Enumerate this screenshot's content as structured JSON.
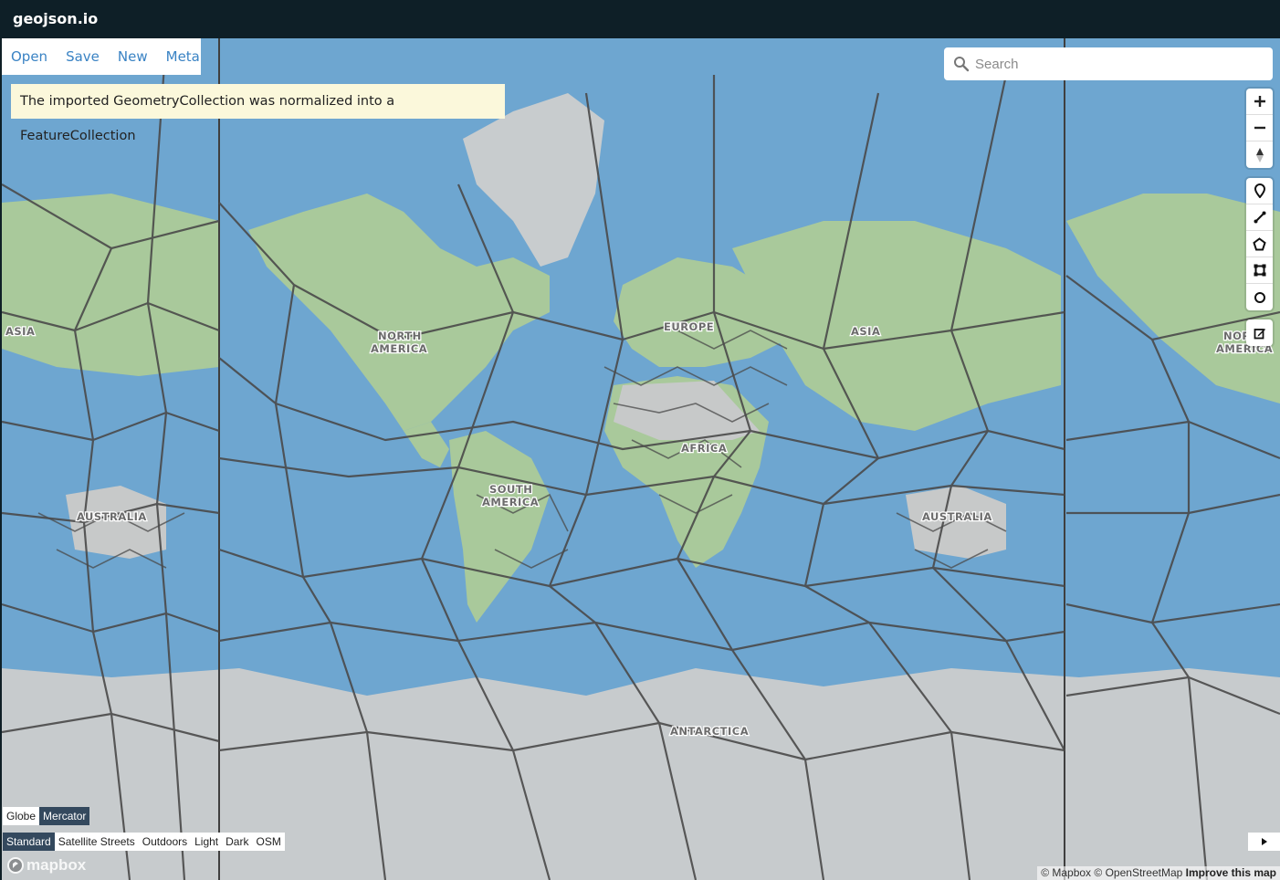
{
  "app": {
    "title": "geojson.io"
  },
  "toolbar": {
    "open": "Open",
    "save": "Save",
    "new": "New",
    "meta": "Meta"
  },
  "notice": {
    "text": "The imported GeometryCollection was normalized into a FeatureCollection"
  },
  "search": {
    "placeholder": "Search",
    "value": ""
  },
  "map": {
    "labels": {
      "asia_left": "ASIA",
      "north_america_1": "NORTH",
      "north_america_2": "AMERICA",
      "europe": "EUROPE",
      "asia_right": "ASIA",
      "nor_right_1": "NOR",
      "nor_right_2": "AMERICA",
      "africa": "AFRICA",
      "south_america_1": "SOUTH",
      "south_america_2": "AMERICA",
      "australia_left": "AUSTRALIA",
      "australia_right": "AUSTRALIA",
      "antarctica": "ANTARCTICA"
    },
    "colors": {
      "ocean": "#6fa6cf",
      "land": "#a8c89a",
      "ice": "#c8ccce",
      "borders": "#4a4a4a"
    }
  },
  "controls": {
    "zoom": [
      "plus-icon",
      "minus-icon",
      "compass-icon"
    ],
    "draw": [
      "marker-icon",
      "line-icon",
      "polygon-icon",
      "rectangle-icon",
      "circle-icon"
    ],
    "edit": [
      "edit-icon"
    ]
  },
  "projection": {
    "options": [
      "Globe",
      "Mercator"
    ],
    "selected": "Mercator"
  },
  "styles": {
    "options": [
      "Standard",
      "Satellite Streets",
      "Outdoors",
      "Light",
      "Dark",
      "OSM"
    ],
    "selected": "Standard"
  },
  "branding": {
    "logo": "mapbox"
  },
  "attribution": {
    "mapbox": "© Mapbox",
    "osm": "© OpenStreetMap",
    "improve": "Improve this map"
  }
}
